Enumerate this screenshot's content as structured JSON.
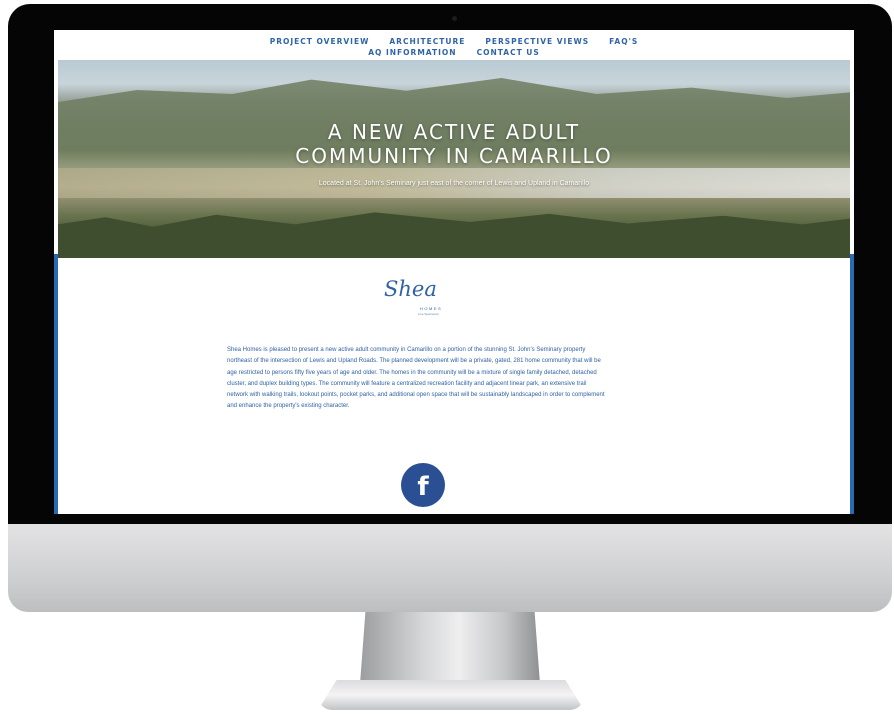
{
  "nav": {
    "row1": [
      "PROJECT OVERVIEW",
      "ARCHITECTURE",
      "PERSPECTIVE VIEWS",
      "FAQ'S"
    ],
    "row2": [
      "AQ INFORMATION",
      "CONTACT US"
    ]
  },
  "hero": {
    "title_line1": "A NEW ACTIVE ADULT",
    "title_line2": "COMMUNITY IN CAMARILLO",
    "subtitle": "Located at St. John's Seminary just east of the corner of Lewis and Upland in Camarillo"
  },
  "logo": {
    "script": "Shea",
    "homes": "HOMES",
    "tagline": "Live Spaciously"
  },
  "intro": {
    "text": "Shea Homes is pleased to present a new active adult community in Camarillo on a portion of the stunning St. John's Seminary property northeast of the intersection of Lewis and Upland Roads. The planned development will be a private, gated, 281 home community that will be age restricted to persons fifty five years of age and older.  The homes in the community will be a mixture of single family detached, detached cluster, and duplex building types.  The community will feature a centralized recreation facility and adjacent linear park, an extensive trail network with walking trails, lookout points, pocket parks, and additional open space that will be sustainably landscaped in order to complement and enhance the property's existing character."
  },
  "social": {
    "facebook_glyph": "f"
  },
  "colors": {
    "link_blue": "#2f64a8",
    "facebook_blue": "#2b4f93",
    "accent_bar": "#2a69b4"
  }
}
